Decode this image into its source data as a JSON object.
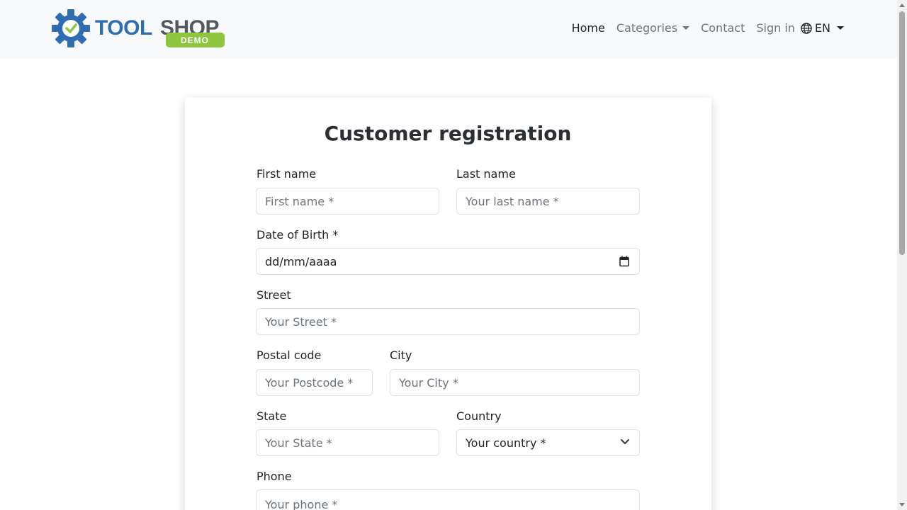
{
  "brand": {
    "logo_text_main": "TOOLSHOP",
    "logo_text_badge": "DEMO",
    "colors": {
      "gear": "#2f6db3",
      "check": "#8dc63f",
      "text_blue": "#2f6db3",
      "text_gray": "#55595c",
      "badge": "#8dc63f"
    }
  },
  "nav": {
    "home": "Home",
    "categories": "Categories",
    "contact": "Contact",
    "sign_in": "Sign in",
    "language": "EN"
  },
  "form": {
    "title": "Customer registration",
    "first_name": {
      "label": "First name",
      "placeholder": "First name *"
    },
    "last_name": {
      "label": "Last name",
      "placeholder": "Your last name *"
    },
    "dob": {
      "label": "Date of Birth *",
      "value": "dd/mm/aaaa"
    },
    "street": {
      "label": "Street",
      "placeholder": "Your Street *"
    },
    "postal_code": {
      "label": "Postal code",
      "placeholder": "Your Postcode *"
    },
    "city": {
      "label": "City",
      "placeholder": "Your City *"
    },
    "state": {
      "label": "State",
      "placeholder": "Your State *"
    },
    "country": {
      "label": "Country",
      "selected": "Your country *"
    },
    "phone": {
      "label": "Phone",
      "placeholder": "Your phone *"
    }
  }
}
